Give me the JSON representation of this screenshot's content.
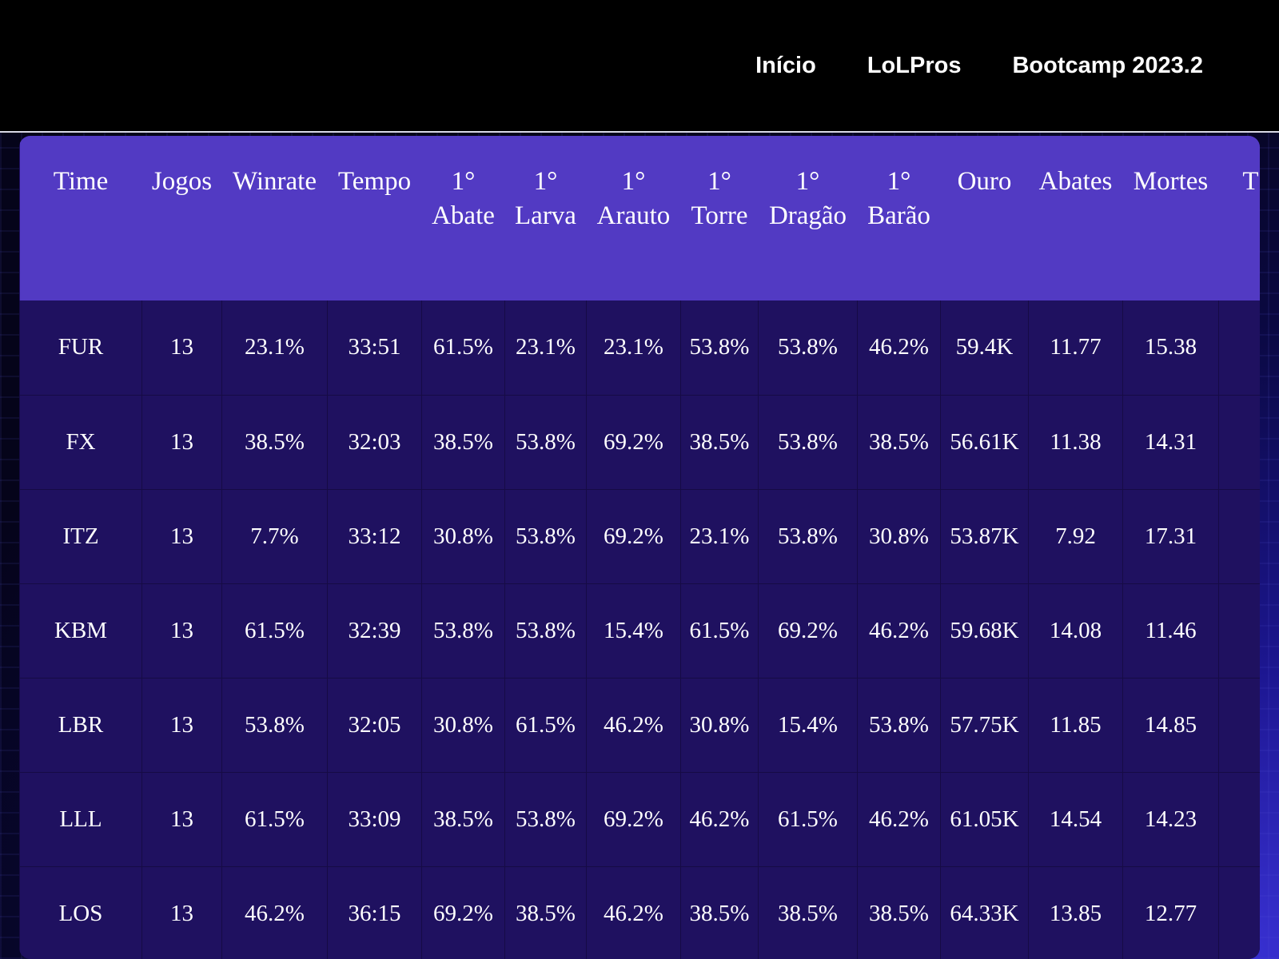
{
  "nav": {
    "items": [
      {
        "label": "Início"
      },
      {
        "label": "LoLPros"
      },
      {
        "label": "Bootcamp 2023.2"
      }
    ]
  },
  "table": {
    "headers": [
      {
        "line1": "Time",
        "line2": ""
      },
      {
        "line1": "Jogos",
        "line2": ""
      },
      {
        "line1": "Winrate",
        "line2": ""
      },
      {
        "line1": "Tempo",
        "line2": ""
      },
      {
        "line1": "1°",
        "line2": "Abate"
      },
      {
        "line1": "1°",
        "line2": "Larva"
      },
      {
        "line1": "1°",
        "line2": "Arauto"
      },
      {
        "line1": "1°",
        "line2": "Torre"
      },
      {
        "line1": "1°",
        "line2": "Dragão"
      },
      {
        "line1": "1°",
        "line2": "Barão"
      },
      {
        "line1": "Ouro",
        "line2": ""
      },
      {
        "line1": "Abates",
        "line2": ""
      },
      {
        "line1": "Mortes",
        "line2": ""
      },
      {
        "line1": "T",
        "line2": ""
      }
    ],
    "rows": [
      [
        "FUR",
        "13",
        "23.1%",
        "33:51",
        "61.5%",
        "23.1%",
        "23.1%",
        "53.8%",
        "53.8%",
        "46.2%",
        "59.4K",
        "11.77",
        "15.38",
        ""
      ],
      [
        "FX",
        "13",
        "38.5%",
        "32:03",
        "38.5%",
        "53.8%",
        "69.2%",
        "38.5%",
        "53.8%",
        "38.5%",
        "56.61K",
        "11.38",
        "14.31",
        ""
      ],
      [
        "ITZ",
        "13",
        "7.7%",
        "33:12",
        "30.8%",
        "53.8%",
        "69.2%",
        "23.1%",
        "53.8%",
        "30.8%",
        "53.87K",
        "7.92",
        "17.31",
        ""
      ],
      [
        "KBM",
        "13",
        "61.5%",
        "32:39",
        "53.8%",
        "53.8%",
        "15.4%",
        "61.5%",
        "69.2%",
        "46.2%",
        "59.68K",
        "14.08",
        "11.46",
        ""
      ],
      [
        "LBR",
        "13",
        "53.8%",
        "32:05",
        "30.8%",
        "61.5%",
        "46.2%",
        "30.8%",
        "15.4%",
        "53.8%",
        "57.75K",
        "11.85",
        "14.85",
        ""
      ],
      [
        "LLL",
        "13",
        "61.5%",
        "33:09",
        "38.5%",
        "53.8%",
        "69.2%",
        "46.2%",
        "61.5%",
        "46.2%",
        "61.05K",
        "14.54",
        "14.23",
        ""
      ],
      [
        "LOS",
        "13",
        "46.2%",
        "36:15",
        "69.2%",
        "38.5%",
        "46.2%",
        "38.5%",
        "38.5%",
        "38.5%",
        "64.33K",
        "13.85",
        "12.77",
        ""
      ]
    ]
  }
}
